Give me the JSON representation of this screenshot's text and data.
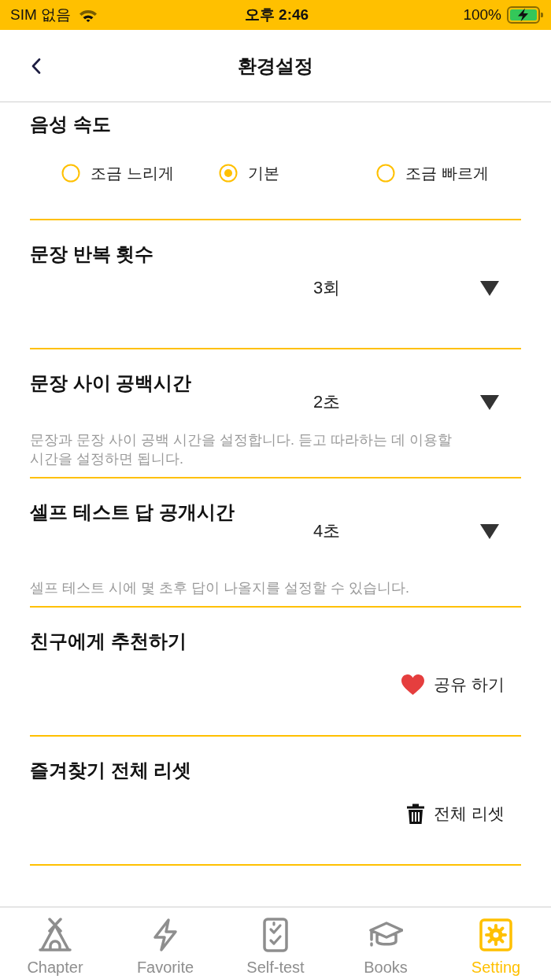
{
  "status_bar": {
    "carrier": "SIM 없음",
    "time": "오후 2:46",
    "battery": "100%"
  },
  "nav": {
    "title": "환경설정"
  },
  "sections": [
    {
      "kind": "radio",
      "title": "음성 속도",
      "options": [
        {
          "label": "조금 느리게",
          "selected": false
        },
        {
          "label": "기본",
          "selected": true
        },
        {
          "label": "조금 빠르게",
          "selected": false
        }
      ]
    },
    {
      "kind": "dropdown",
      "title": "문장 반복 횟수",
      "value": "3회"
    },
    {
      "kind": "dropdown",
      "title": "문장 사이 공백시간",
      "value": "2초",
      "description": "문장과 문장 사이 공백 시간을 설정합니다. 듣고 따라하는 데 이용할 시간을 설정하면 됩니다."
    },
    {
      "kind": "dropdown",
      "title": "셀프 테스트 답 공개시간",
      "value": "4초",
      "description": "셀프 테스트 시에 몇 초후 답이 나올지를 설정할 수 있습니다."
    },
    {
      "kind": "action",
      "title": "친구에게 추천하기",
      "action": {
        "kind": "share",
        "label": "공유 하기"
      }
    },
    {
      "kind": "action",
      "title": "즐겨찾기 전체 리셋",
      "action": {
        "kind": "reset",
        "label": "전체 리셋"
      }
    }
  ],
  "tab_bar": {
    "tabs": [
      {
        "label": "Chapter",
        "selected": false
      },
      {
        "label": "Favorite",
        "selected": false
      },
      {
        "label": "Self-test",
        "selected": false
      },
      {
        "label": "Books",
        "selected": false
      },
      {
        "label": "Setting",
        "selected": true
      }
    ]
  }
}
